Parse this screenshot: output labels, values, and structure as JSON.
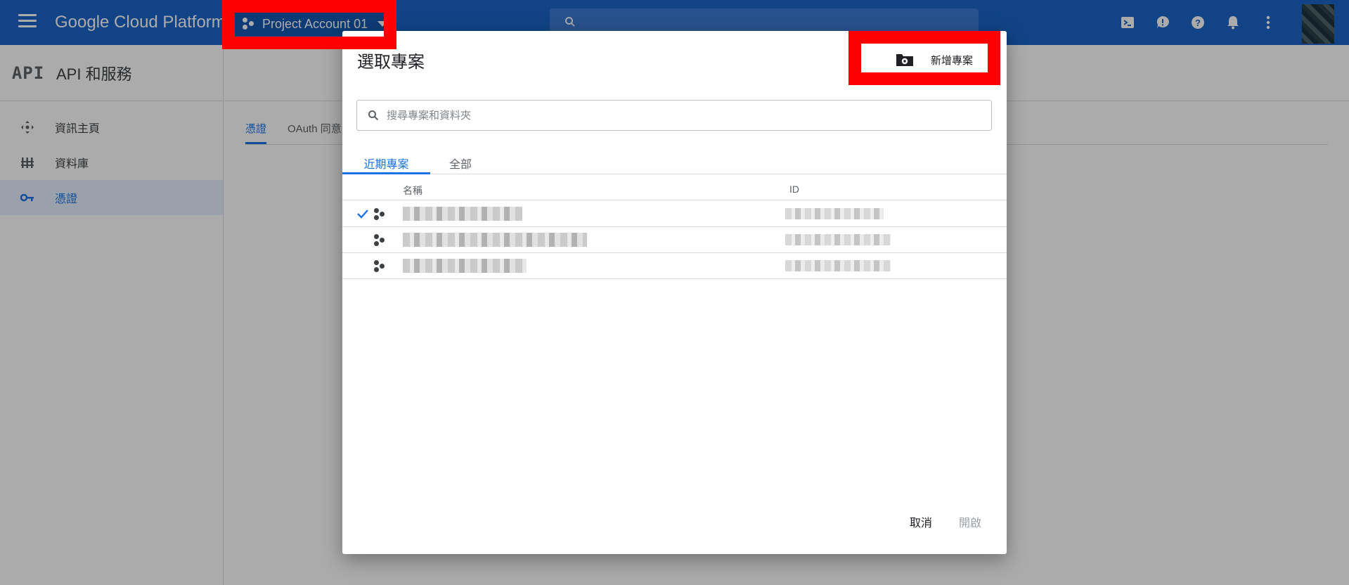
{
  "topbar": {
    "brand": "Google Cloud Platform",
    "project_name": "Project Account 01",
    "icons": [
      "menu-icon",
      "project-dots-icon",
      "search-icon",
      "cloud-shell-icon",
      "feedback-icon",
      "help-icon",
      "notifications-icon",
      "more-vert-icon"
    ],
    "color": "#1a64c8"
  },
  "sidebar": {
    "logo": "API",
    "title": "API 和服務",
    "items": [
      {
        "label": "資訊主頁",
        "icon": "dashboard-icon"
      },
      {
        "label": "資料庫",
        "icon": "library-icon"
      },
      {
        "label": "憑證",
        "icon": "key-icon",
        "active": true
      }
    ]
  },
  "content": {
    "tabs": [
      {
        "label": "憑證",
        "active": true
      },
      {
        "label": "OAuth 同意"
      }
    ]
  },
  "dialog": {
    "title": "選取專案",
    "new_project_label": "新增專案",
    "search_placeholder": "搜尋專案和資料夾",
    "tabs": [
      {
        "label": "近期專案",
        "active": true
      },
      {
        "label": "全部"
      }
    ],
    "columns": {
      "name": "名稱",
      "id": "ID"
    },
    "rows": [
      {
        "selected": true
      },
      {
        "selected": false
      },
      {
        "selected": false
      }
    ],
    "cancel_label": "取消",
    "open_label": "開啟"
  },
  "accent_color": "#1a73e8",
  "highlight_color": "#ff0000"
}
